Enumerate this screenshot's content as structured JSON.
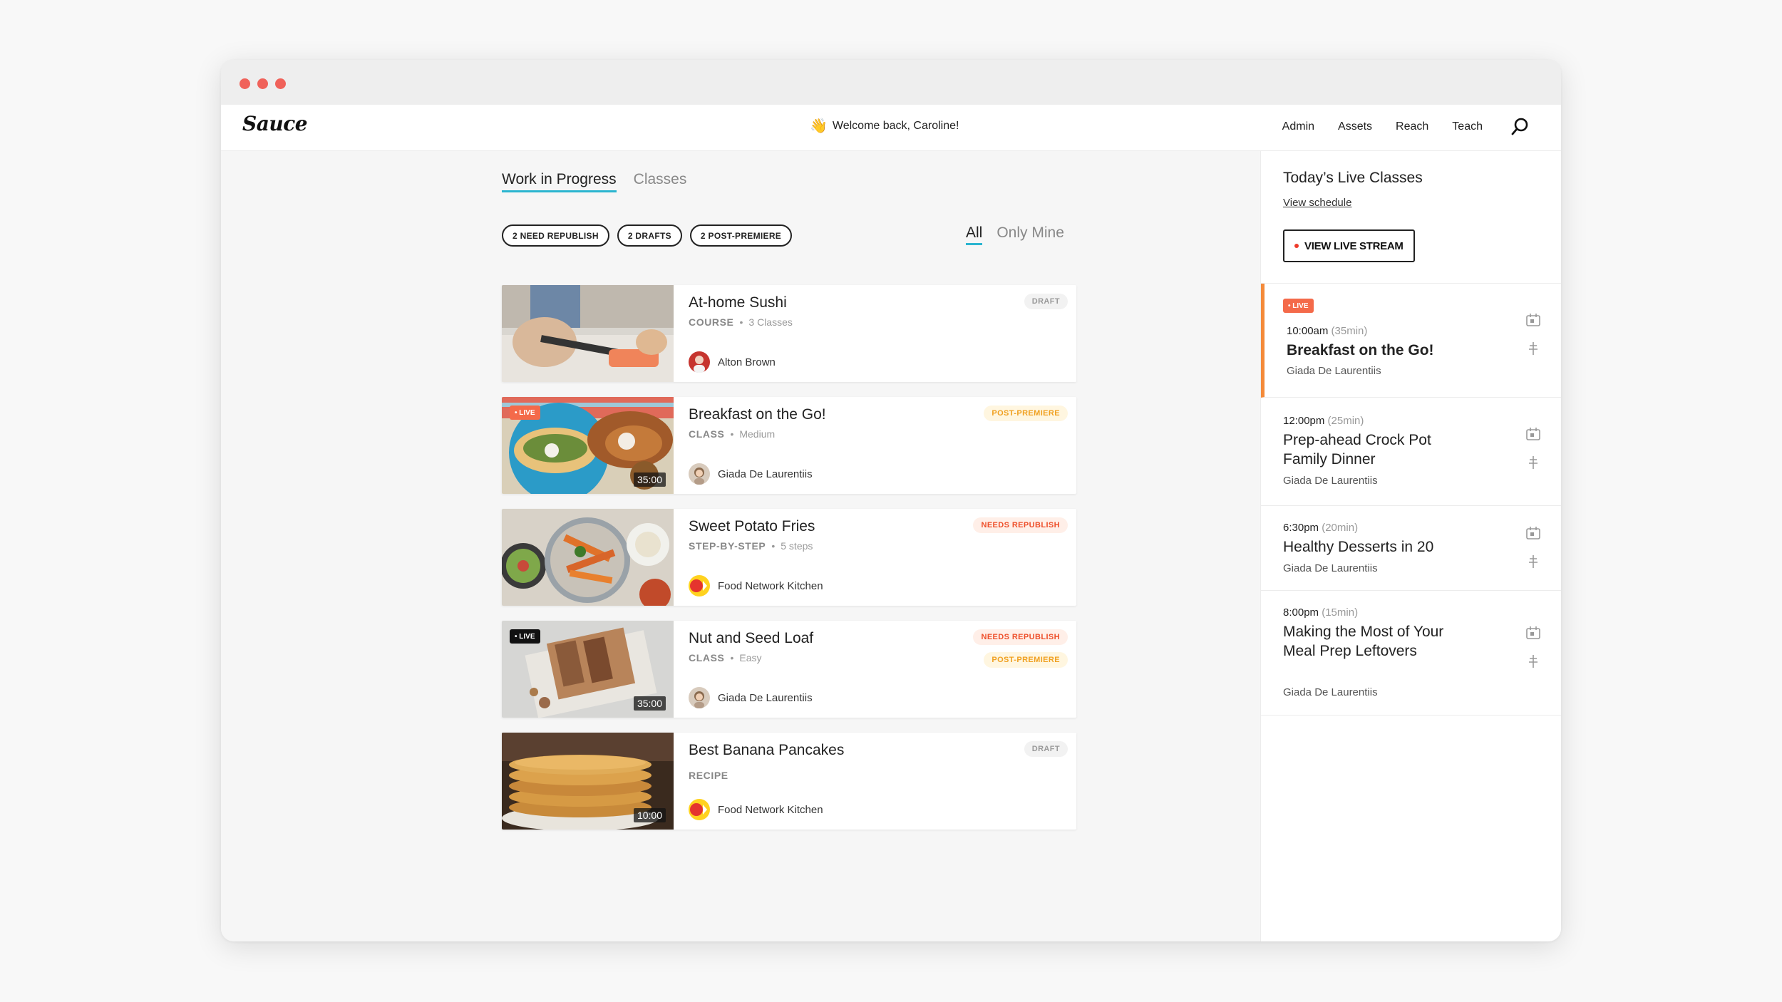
{
  "colors": {
    "accent": "#2bb5d0",
    "live": "#f46a4a",
    "needs_republish": "#ee4f2a",
    "post_premiere": "#f0a020"
  },
  "nav": {
    "logo": "Sauce",
    "welcome": "Welcome back, Caroline!",
    "welcome_icon": "waving-hand-emoji",
    "links": [
      "Admin",
      "Assets",
      "Reach",
      "Teach"
    ],
    "search_icon": "search-icon"
  },
  "tabs": {
    "work": "Work in Progress",
    "classes": "Classes"
  },
  "filters": {
    "republish": "2 NEED REPUBLISH",
    "drafts": "2 DRAFTS",
    "post_premiere": "2 POST-PREMIERE"
  },
  "scope": {
    "all": "All",
    "mine": "Only Mine"
  },
  "cards": [
    {
      "title": "At-home Sushi",
      "type": "COURSE",
      "detail": "3 Classes",
      "author": "Alton Brown",
      "statuses": [
        "DRAFT"
      ]
    },
    {
      "title": "Breakfast on the Go!",
      "type": "CLASS",
      "detail": "Medium",
      "author": "Giada De Laurentiis",
      "live": "• LIVE",
      "duration": "35:00",
      "statuses": [
        "POST-PREMIERE"
      ]
    },
    {
      "title": "Sweet Potato Fries",
      "type": "STEP-BY-STEP",
      "detail": "5 steps",
      "author": "Food Network Kitchen",
      "statuses": [
        "NEEDS REPUBLISH"
      ]
    },
    {
      "title": "Nut and Seed Loaf",
      "type": "CLASS",
      "detail": "Easy",
      "author": "Giada De Laurentiis",
      "live": "• LIVE",
      "duration": "35:00",
      "statuses": [
        "NEEDS REPUBLISH",
        "POST-PREMIERE"
      ]
    },
    {
      "title": "Best Banana Pancakes",
      "type": "RECIPE",
      "detail": "",
      "author": "Food Network Kitchen",
      "duration": "10:00",
      "statuses": [
        "DRAFT"
      ]
    }
  ],
  "side": {
    "title": "Today’s Live Classes",
    "link": "View schedule",
    "button": "VIEW LIVE STREAM",
    "slots": [
      {
        "badge": "• LIVE",
        "time": "10:00am",
        "dur": "(35min)",
        "title": "Breakfast on the Go!",
        "host": "Giada De Laurentiis"
      },
      {
        "time": "12:00pm",
        "dur": "(25min)",
        "title": "Prep-ahead Crock Pot Family Dinner",
        "host": "Giada De Laurentiis"
      },
      {
        "time": "6:30pm",
        "dur": "(20min)",
        "title": "Healthy Desserts in 20",
        "host": "Giada De Laurentiis"
      },
      {
        "time": "8:00pm",
        "dur": "(15min)",
        "title": "Making the Most of Your Meal Prep Leftovers",
        "host": "Giada De Laurentiis"
      }
    ]
  }
}
